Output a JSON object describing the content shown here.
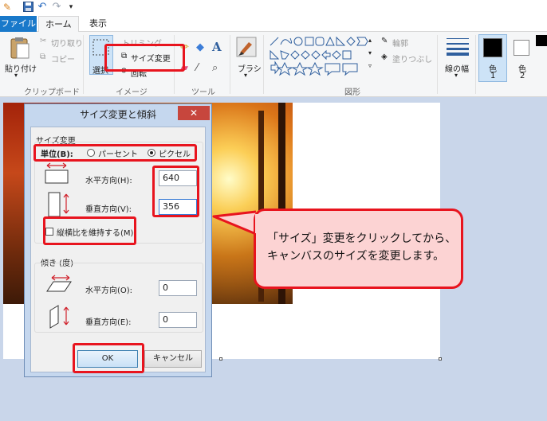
{
  "ribbon_tabs": [
    {
      "label": "ファイル"
    },
    {
      "label": "ホーム"
    },
    {
      "label": "表示"
    }
  ],
  "clipboard": {
    "paste_label": "貼り付け",
    "cut_label": "切り取り",
    "copy_label": "コピー",
    "group_label": "クリップボード"
  },
  "image_group": {
    "select_label": "選択",
    "crop_label": "トリミング",
    "resize_label": "サイズ変更",
    "rotate_label": "回転",
    "group_label": "イメージ"
  },
  "tools_group": {
    "group_label": "ツール"
  },
  "brush": {
    "label": "ブラシ"
  },
  "shapes_group": {
    "outline_label": "輪郭",
    "fill_label": "塗りつぶし",
    "group_label": "図形"
  },
  "line_width": {
    "label": "線の幅"
  },
  "colors": {
    "color1_label": "色",
    "color1_number": "1",
    "color2_label": "色",
    "color2_number": "2",
    "color1_value": "#000000",
    "color2_value": "#ffffff"
  },
  "dialog": {
    "title": "サイズ変更と傾斜",
    "close_glyph": "✕",
    "resize_section": "サイズ変更",
    "unit_label": "単位(B):",
    "unit_percent": "パーセント",
    "unit_pixel": "ピクセル",
    "unit_selected": "ピクセル",
    "horizontal_label": "水平方向(H):",
    "horizontal_value": "640",
    "vertical_label": "垂直方向(V):",
    "vertical_value": "356",
    "keep_aspect_label": "縦横比を維持する(M)",
    "keep_aspect_checked": false,
    "skew_section": "傾き (度)",
    "skew_h_label": "水平方向(O):",
    "skew_h_value": "0",
    "skew_v_label": "垂直方向(E):",
    "skew_v_value": "0",
    "ok_label": "OK",
    "cancel_label": "キャンセル"
  },
  "callout": {
    "line1": "「サイズ」変更をクリックしてから、",
    "line2": "キャンバスのサイズを変更します。"
  },
  "accent": {
    "highlight": "#e8141e",
    "callout_fill": "#fcd3d3",
    "file_tab": "#1979ca"
  }
}
